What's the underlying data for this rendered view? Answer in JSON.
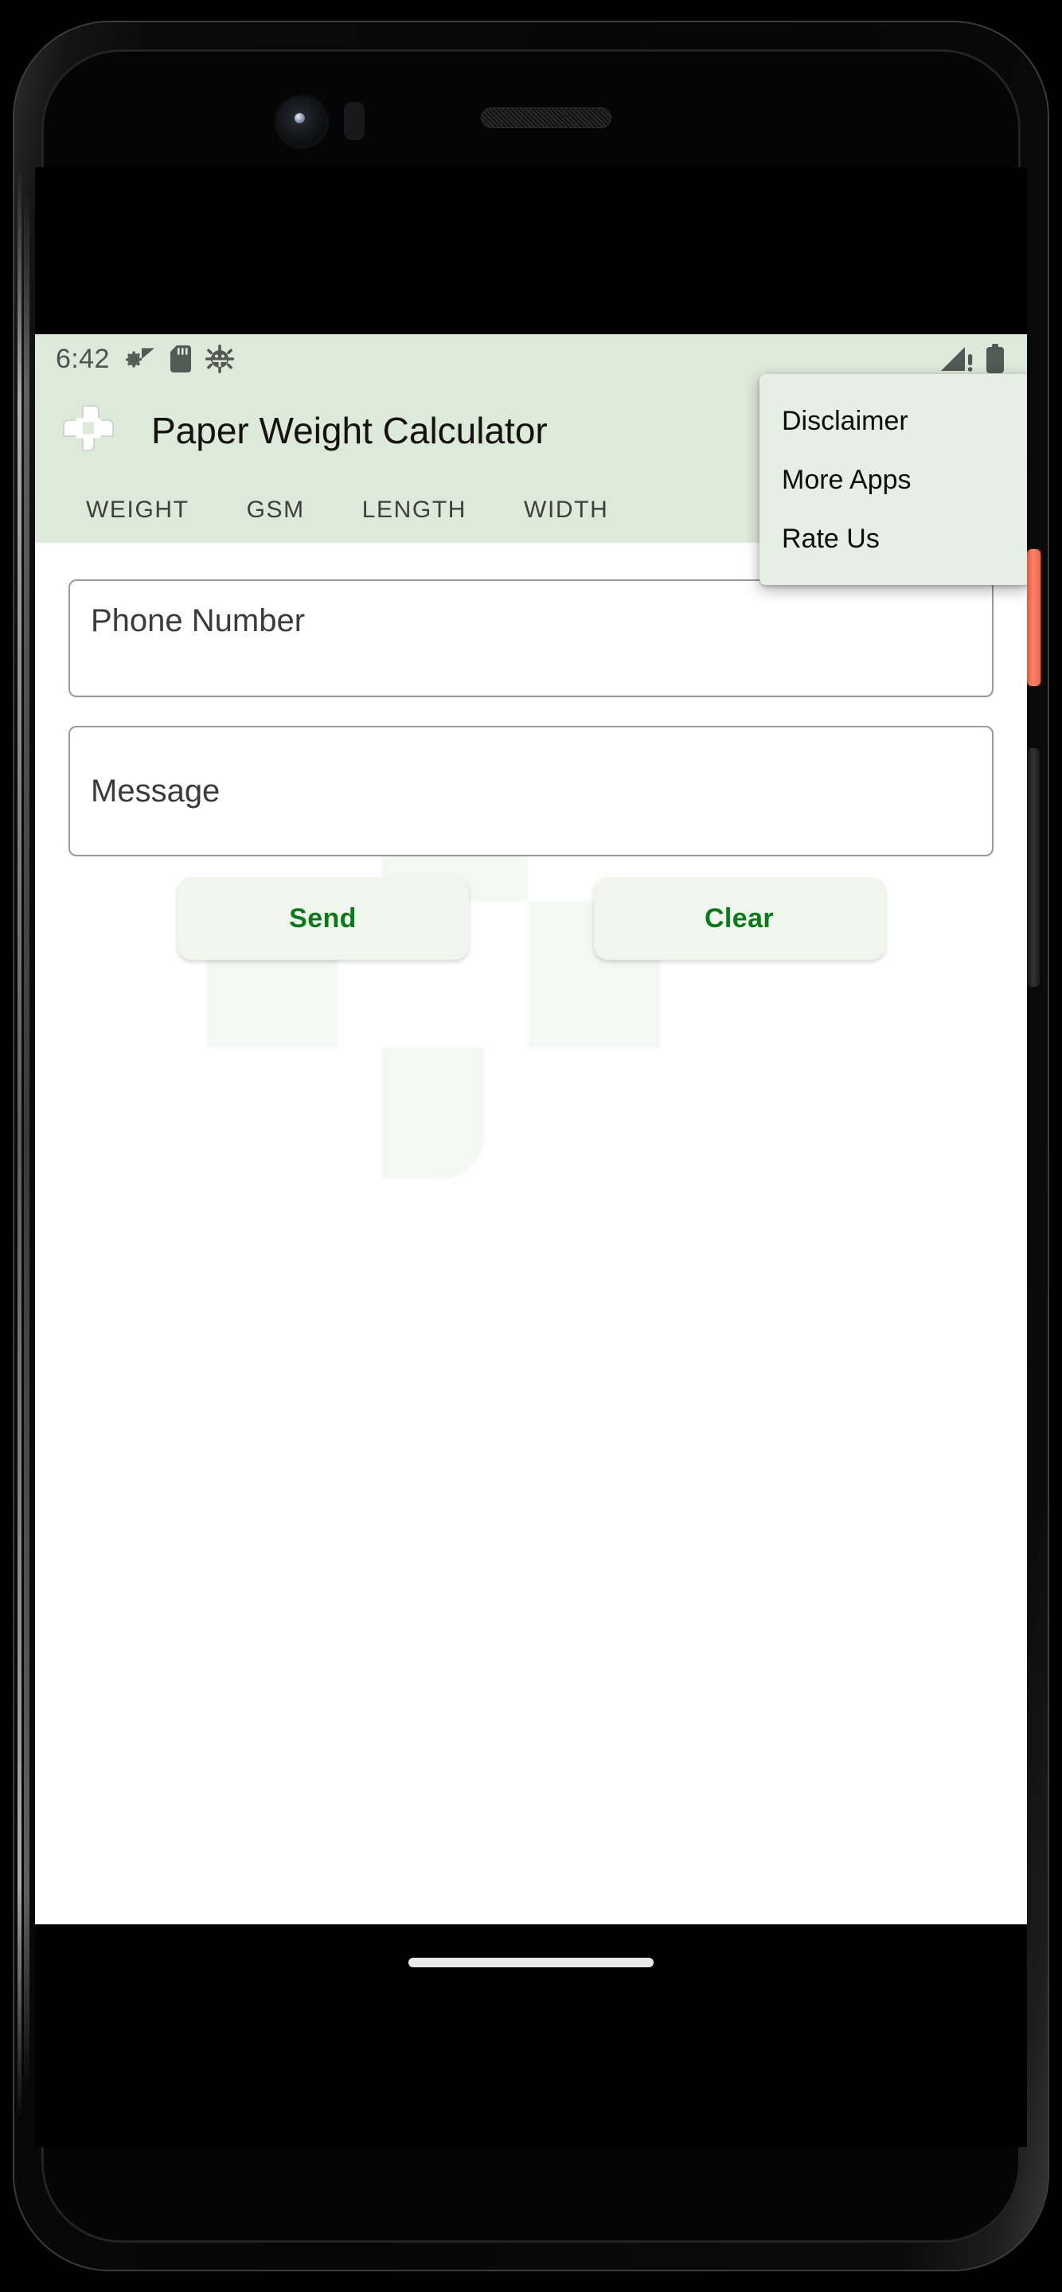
{
  "device": {
    "frame_color": "#0a0a0a",
    "power_button_color": "#f0624a",
    "camera_label": "front-camera",
    "speaker_label": "earpiece-speaker"
  },
  "status_bar": {
    "time": "6:42",
    "background": "#dde9d9",
    "icon_color": "#515a54",
    "left_icons": [
      "settings-sync-icon",
      "sd-card-icon",
      "android-debug-icon"
    ],
    "right_icons": [
      "cellular-no-sim-icon",
      "battery-full-icon"
    ]
  },
  "app_bar": {
    "title": "Paper Weight Calculator",
    "logo_icon": "pinwheel-logo-icon",
    "background": "#dde9d9",
    "title_color": "#13120f"
  },
  "tabs": {
    "items": [
      {
        "label": "WEIGHT"
      },
      {
        "label": "GSM"
      },
      {
        "label": "LENGTH"
      },
      {
        "label": "WIDTH"
      }
    ],
    "selected_index": 0,
    "text_color": "#39423c"
  },
  "overflow_menu": {
    "visible": true,
    "background": "#e6efe3",
    "items": [
      {
        "label": "Disclaimer"
      },
      {
        "label": "More Apps"
      },
      {
        "label": "Rate Us"
      }
    ]
  },
  "form": {
    "phone_number": {
      "value": "",
      "placeholder": "Phone Number"
    },
    "message": {
      "value": "",
      "placeholder": "Message"
    },
    "buttons": {
      "send_label": "Send",
      "clear_label": "Clear",
      "text_color": "#0b7a18",
      "background": "#f0f5ee"
    }
  },
  "content": {
    "background": "#ffffff",
    "watermark_icon": "pinwheel-logo-watermark",
    "watermark_color": "#e7f1e6"
  },
  "nav_bar": {
    "background": "#000000",
    "gesture_pill_color": "#e9e9e9"
  }
}
